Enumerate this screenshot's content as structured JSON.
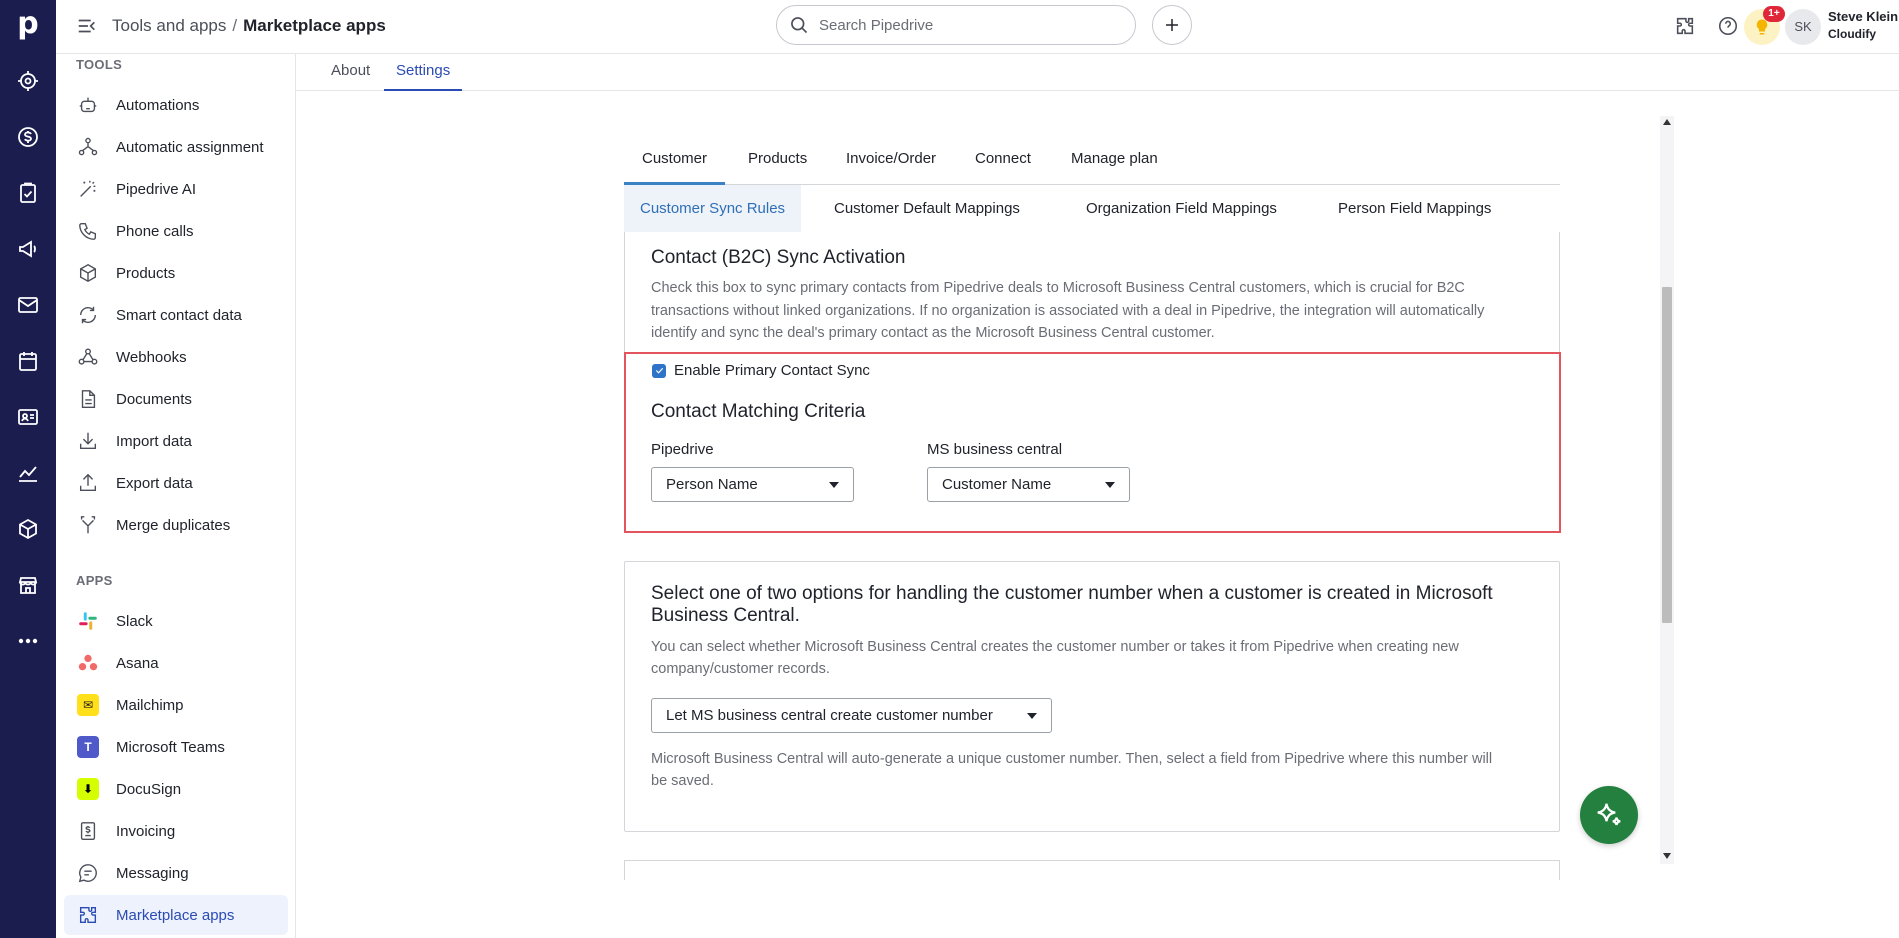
{
  "brand": {
    "logo_letter": "p",
    "rail_color": "#1b1d4e",
    "accent": "#2a4bb3"
  },
  "header": {
    "breadcrumb": {
      "parent": "Tools and apps",
      "separator": "/",
      "current": "Marketplace apps"
    },
    "search_placeholder": "Search Pipedrive",
    "tips_badge": "1+",
    "user": {
      "initials": "SK",
      "name": "Steve Klein",
      "company": "Cloudify"
    }
  },
  "rail": {
    "icons": [
      "leads-icon",
      "deals-icon",
      "activities-icon",
      "campaigns-icon",
      "mail-icon",
      "calendar-icon",
      "contacts-icon",
      "insights-icon",
      "products-icon",
      "marketplace-icon",
      "more-icon"
    ]
  },
  "sidebar": {
    "tools_heading": "TOOLS",
    "tools": [
      {
        "label": "Automations",
        "icon": "robot-icon"
      },
      {
        "label": "Automatic assignment",
        "icon": "assignment-icon"
      },
      {
        "label": "Pipedrive AI",
        "icon": "magic-wand-icon"
      },
      {
        "label": "Phone calls",
        "icon": "phone-icon"
      },
      {
        "label": "Products",
        "icon": "box-icon"
      },
      {
        "label": "Smart contact data",
        "icon": "sync-icon"
      },
      {
        "label": "Webhooks",
        "icon": "webhook-icon"
      },
      {
        "label": "Documents",
        "icon": "document-icon"
      },
      {
        "label": "Import data",
        "icon": "import-icon"
      },
      {
        "label": "Export data",
        "icon": "export-icon"
      },
      {
        "label": "Merge duplicates",
        "icon": "merge-icon"
      }
    ],
    "apps_heading": "APPS",
    "apps": [
      {
        "label": "Slack",
        "icon": "slack-icon"
      },
      {
        "label": "Asana",
        "icon": "asana-icon"
      },
      {
        "label": "Mailchimp",
        "icon": "mailchimp-icon"
      },
      {
        "label": "Microsoft Teams",
        "icon": "teams-icon"
      },
      {
        "label": "DocuSign",
        "icon": "docusign-icon"
      },
      {
        "label": "Invoicing",
        "icon": "invoice-icon"
      },
      {
        "label": "Messaging",
        "icon": "chat-icon"
      },
      {
        "label": "Marketplace apps",
        "icon": "puzzle-icon",
        "active": true
      }
    ]
  },
  "settings_tabs": {
    "about": "About",
    "settings": "Settings"
  },
  "app": {
    "tabs": [
      "Customer",
      "Products",
      "Invoice/Order",
      "Connect",
      "Manage plan"
    ],
    "sub_tabs": [
      "Customer Sync Rules",
      "Customer Default Mappings",
      "Organization Field Mappings",
      "Person Field Mappings"
    ],
    "b2c": {
      "title": "Contact (B2C) Sync Activation",
      "description_lines": [
        "Check this box to sync primary contacts from Pipedrive deals to Microsoft Business Central customers, which is crucial for B2C",
        "transactions without linked organizations. If no organization is associated with a deal in Pipedrive, the integration will automatically",
        "identify and sync the deal's primary contact as the Microsoft Business Central customer."
      ],
      "checkbox_label": "Enable Primary Contact Sync",
      "checkbox_checked": true,
      "matching_title": "Contact Matching Criteria",
      "pipedrive_label": "Pipedrive",
      "pipedrive_value": "Person Name",
      "msbc_label": "MS business central",
      "msbc_value": "Customer Name"
    },
    "customer_number": {
      "title_lines": [
        "Select one of two options for handling the customer number when a customer is created in Microsoft",
        "Business Central."
      ],
      "description_lines": [
        "You can select whether Microsoft Business Central creates the customer number or takes it from Pipedrive when creating new",
        "company/customer records."
      ],
      "select_value": "Let MS business central create customer number",
      "note_lines": [
        "Microsoft Business Central will auto-generate a unique customer number. Then, select a field from Pipedrive where this number will",
        "be saved."
      ]
    }
  }
}
